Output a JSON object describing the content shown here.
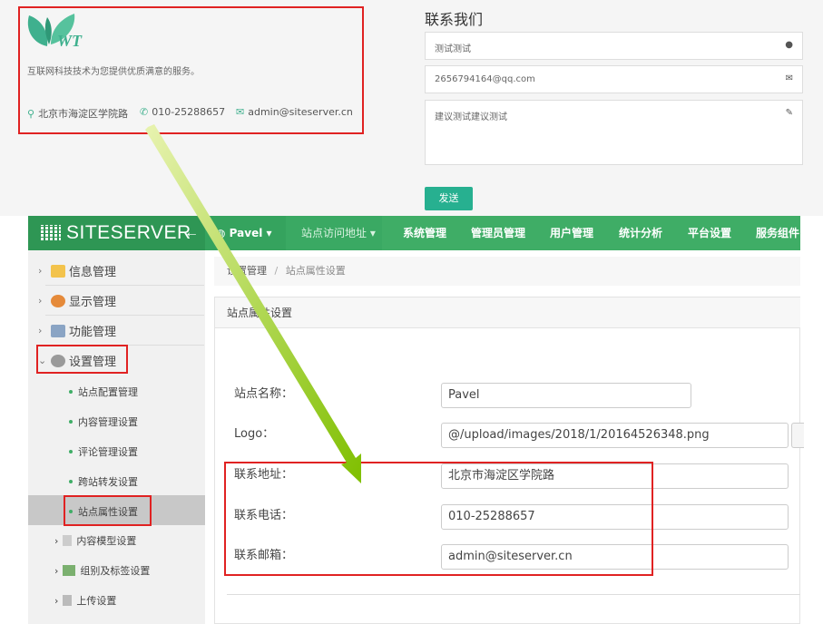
{
  "site_footer": {
    "logo_text": "WT",
    "slogan": "互联网科技技术为您提供优质满意的服务。",
    "address": "北京市海淀区学院路",
    "phone": "010-25288657",
    "email": "admin@siteserver.cn"
  },
  "contact_form": {
    "title": "联系我们",
    "name_value": "测试测试",
    "email_value": "2656794164@qq.com",
    "message_value": "建议测试建议测试",
    "send_label": "发送"
  },
  "header": {
    "brand": "SITESERVER",
    "site_menu": "Pavel",
    "nav": [
      "站点访问地址",
      "系统管理",
      "管理员管理",
      "用户管理",
      "统计分析",
      "平台设置",
      "服务组件"
    ]
  },
  "sidebar": {
    "top_items": [
      "信息管理",
      "显示管理",
      "功能管理",
      "设置管理"
    ],
    "settings_sub": [
      "站点配置管理",
      "内容管理设置",
      "评论管理设置",
      "跨站转发设置",
      "站点属性设置"
    ],
    "folders": [
      "内容模型设置",
      "组别及标签设置",
      "上传设置"
    ]
  },
  "breadcrumb": {
    "parent": "设置管理",
    "sep": "/",
    "current": "站点属性设置"
  },
  "form": {
    "panel_title": "站点属性设置",
    "fields": [
      {
        "label": "站点名称：",
        "value": "Pavel"
      },
      {
        "label": "Logo：",
        "value": "@/upload/images/2018/1/20164526348.png"
      },
      {
        "label": "联系地址：",
        "value": "北京市海淀区学院路"
      },
      {
        "label": "联系电话：",
        "value": "010-25288657"
      },
      {
        "label": "联系邮箱：",
        "value": "admin@siteserver.cn"
      }
    ]
  },
  "colors": {
    "brand_green": "#3fad66",
    "highlight_red": "#e02222",
    "arrow_green": "#8bc400",
    "send_button": "#27b090"
  }
}
